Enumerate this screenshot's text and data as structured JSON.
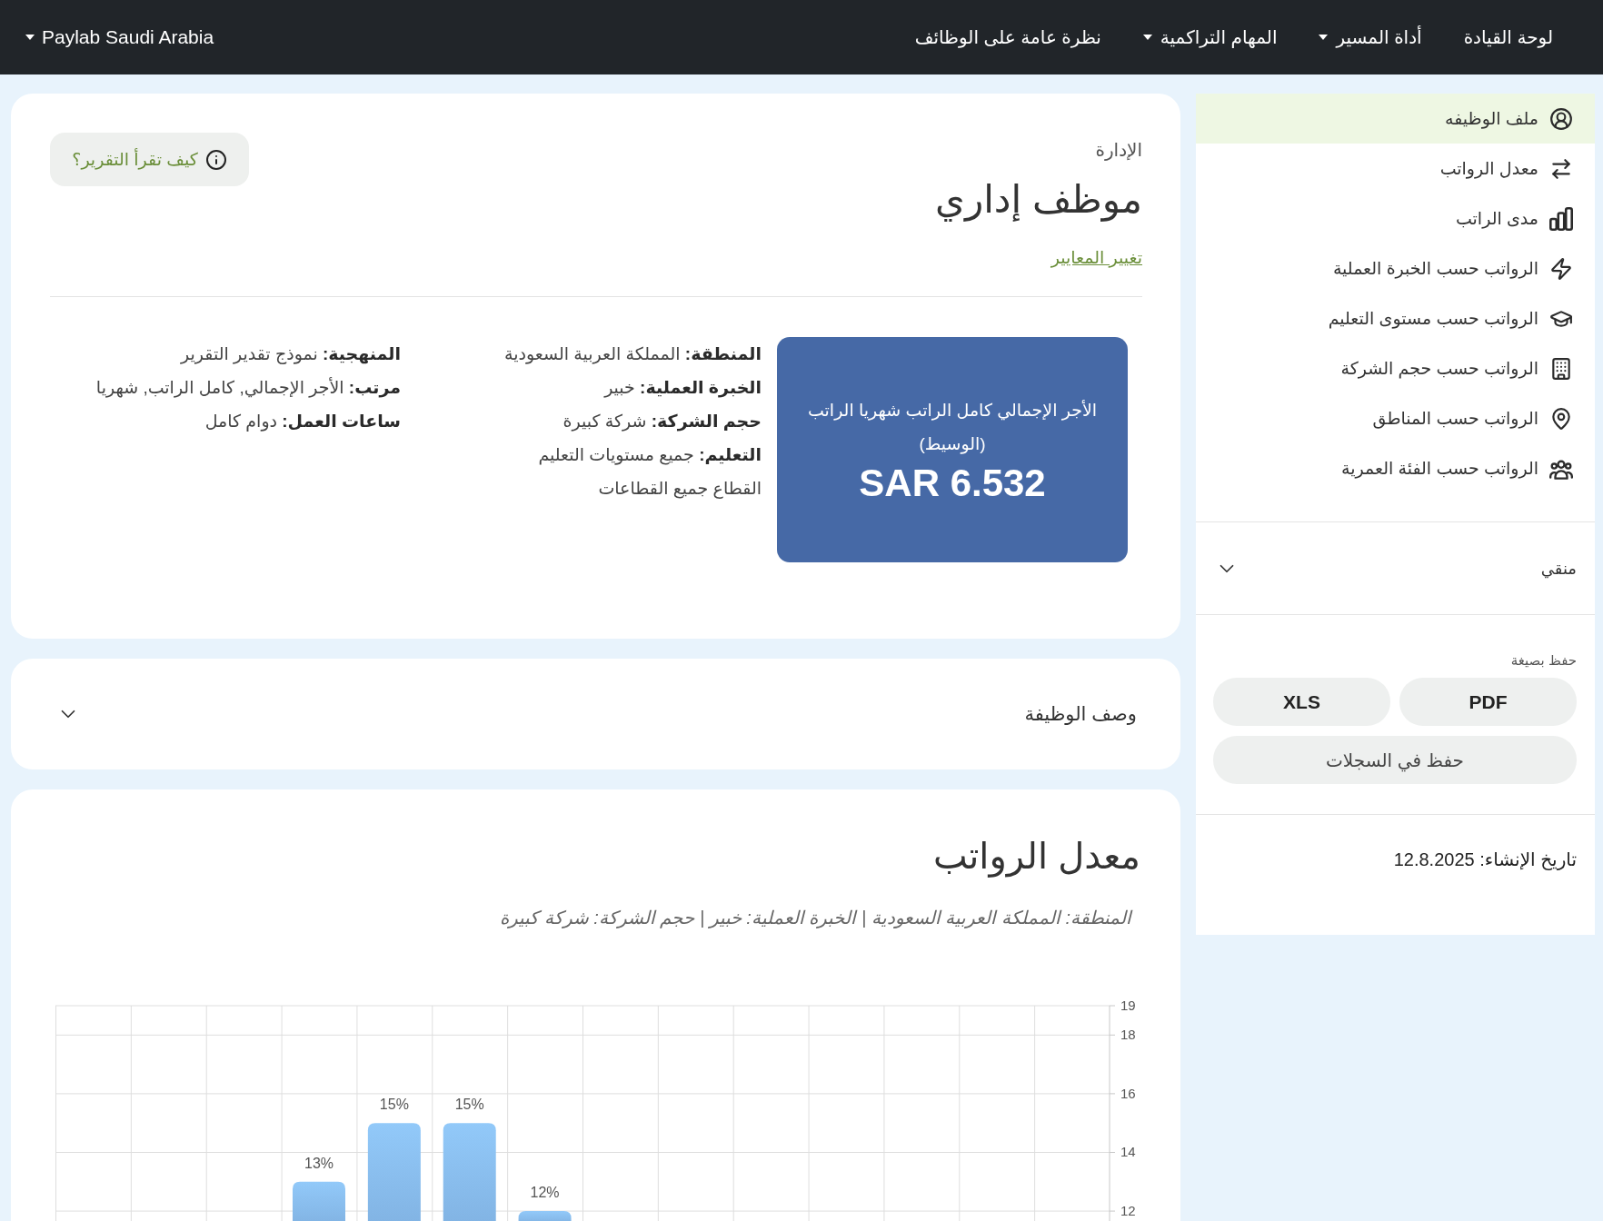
{
  "navbar": {
    "brand": {
      "label": "Paylab Saudi Arabia",
      "has_menu": true
    },
    "items": [
      {
        "label": "لوحة القيادة",
        "has_menu": false
      },
      {
        "label": "أداة المسير",
        "has_menu": true
      },
      {
        "label": "المهام التراكمية",
        "has_menu": true
      },
      {
        "label": "نظرة عامة على الوظائف",
        "has_menu": false
      }
    ]
  },
  "profile": {
    "category": "الإدارة",
    "title": "موظف إداري",
    "change_link": "تغيير المعايير",
    "help_button": "كيف تقرأ التقرير؟",
    "median": {
      "label": "الأجر الإجمالي كامل الراتب شهريا الراتب (الوسيط)",
      "value": "SAR 6.532"
    },
    "criteria": [
      "**المنطقة:** المملكة العربية السعودية",
      "**الخبرة العملية:** خبير",
      "**حجم الشركة:** شركة كبيرة",
      "**التعليم:** جميع مستويات التعليم",
      "القطاع جميع القطاعات"
    ],
    "details": [
      "**المنهجية:** نموذج تقدير التقرير",
      "**مرتب:** الأجر الإجمالي, كامل الراتب, شهريا",
      "**ساعات العمل:** دوام كامل"
    ]
  },
  "job_description": {
    "title": "وصف الوظيفة",
    "expanded": false
  },
  "salary_rate": {
    "title": "معدل الرواتب",
    "subtitle": "المنطقة: المملكة العربية السعودية | الخبرة العملية: خبير | حجم الشركة: شركة كبيرة",
    "chart_data": {
      "type": "bar",
      "values": [
        null,
        null,
        null,
        13,
        15,
        15,
        12,
        null,
        null,
        null,
        null,
        null,
        null,
        null
      ],
      "value_labels": [
        null,
        null,
        null,
        "13%",
        "15%",
        "15%",
        "12%",
        null,
        null,
        null,
        null,
        null,
        null,
        null
      ],
      "ylim": [
        11.6,
        19
      ],
      "yticks": [
        12,
        14,
        16,
        18,
        19
      ],
      "grid": true
    }
  },
  "sidebar": {
    "items": [
      {
        "label": "ملف الوظيفه",
        "selected": true
      },
      {
        "label": "معدل الرواتب",
        "selected": false
      },
      {
        "label": "مدى الراتب",
        "selected": false
      },
      {
        "label": "الرواتب حسب الخبرة العملية",
        "selected": false
      },
      {
        "label": "الرواتب حسب مستوى التعليم",
        "selected": false
      },
      {
        "label": "الرواتب حسب حجم الشركة",
        "selected": false
      },
      {
        "label": "الرواتب حسب المناطق",
        "selected": false
      },
      {
        "label": "الرواتب حسب الفئة العمرية",
        "selected": false
      }
    ],
    "filter": {
      "label": "منقي",
      "expanded": false
    },
    "export": {
      "label": "حفظ بصيغة",
      "formats": [
        "PDF",
        "XLS"
      ],
      "save_button": "حفظ في السجلات"
    },
    "created": "تاريخ الإنشاء: 12.8.2025"
  }
}
